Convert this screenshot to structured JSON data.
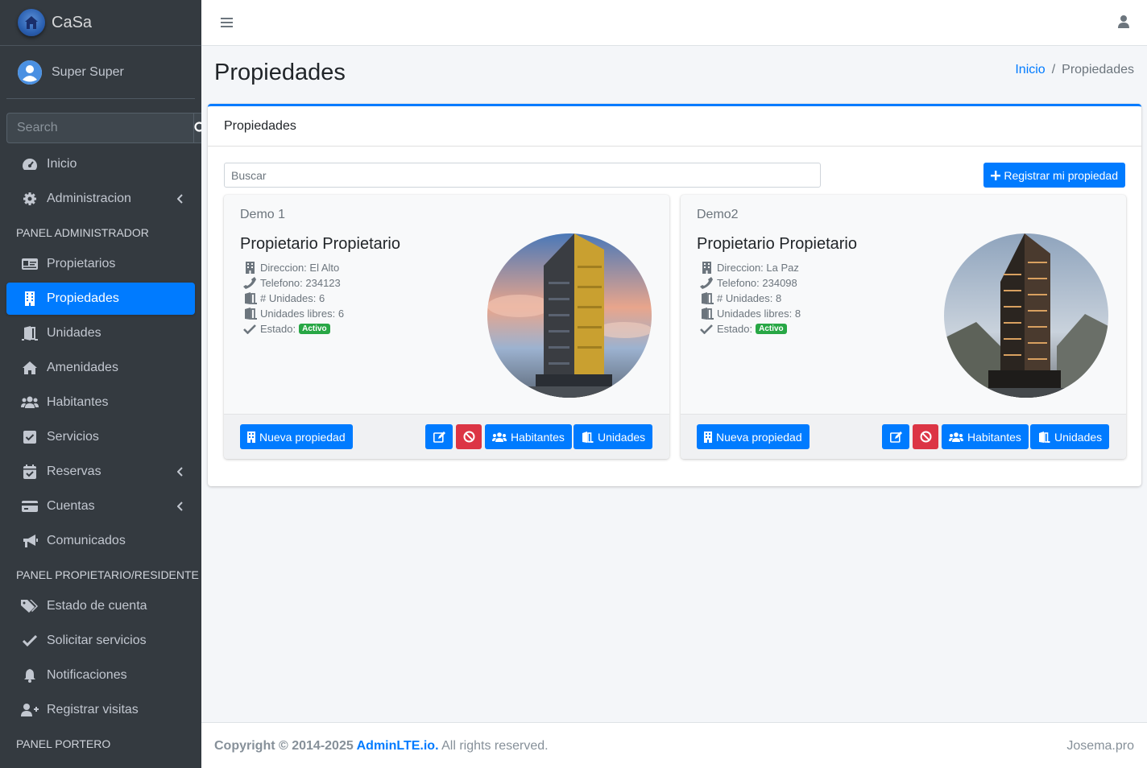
{
  "brand": {
    "name": "CaSa"
  },
  "user": {
    "name": "Super Super"
  },
  "sidebar": {
    "search_placeholder": "Search",
    "items": [
      {
        "label": "Inicio"
      },
      {
        "label": "Administracion"
      },
      {
        "header": "PANEL ADMINISTRADOR"
      },
      {
        "label": "Propietarios"
      },
      {
        "label": "Propiedades"
      },
      {
        "label": "Unidades"
      },
      {
        "label": "Amenidades"
      },
      {
        "label": "Habitantes"
      },
      {
        "label": "Servicios"
      },
      {
        "label": "Reservas"
      },
      {
        "label": "Cuentas"
      },
      {
        "label": "Comunicados"
      },
      {
        "header": "PANEL PROPIETARIO/RESIDENTE"
      },
      {
        "label": "Estado de cuenta"
      },
      {
        "label": "Solicitar servicios"
      },
      {
        "label": "Notificaciones"
      },
      {
        "label": "Registrar visitas"
      },
      {
        "header": "PANEL PORTERO"
      }
    ]
  },
  "header": {
    "title": "Propiedades",
    "breadcrumb": [
      "Inicio",
      "/",
      "Propiedades"
    ]
  },
  "main": {
    "card_title": "Propiedades",
    "search_placeholder": "Buscar",
    "register_label": "Registrar mi propiedad",
    "properties": [
      {
        "name": "Demo 1",
        "owner": "Propietario Propietario",
        "direccion": "Direccion: El Alto",
        "telefono": "Telefono: 234123",
        "unidades": "# Unidades: 6",
        "libres": "Unidades libres: 6",
        "estado": "Estado:",
        "badge": "Activo",
        "btn_nueva": "Nueva propiedad",
        "btn_habitantes": "Habitantes",
        "btn_unidades": "Unidades"
      },
      {
        "name": "Demo2",
        "owner": "Propietario Propietario",
        "direccion": "Direccion: La Paz",
        "telefono": "Telefono: 234098",
        "unidades": "# Unidades: 8",
        "libres": "Unidades libres: 8",
        "estado": "Estado:",
        "badge": "Activo",
        "btn_nueva": "Nueva propiedad",
        "btn_habitantes": "Habitantes",
        "btn_unidades": "Unidades"
      }
    ]
  },
  "footer": {
    "copyright": "Copyright © 2014-2025",
    "brand": "AdminLTE.io.",
    "rights": "All rights reserved.",
    "right": "Josema.pro"
  },
  "colors": {
    "primary": "#007bff",
    "danger": "#dc3545",
    "success": "#28a745",
    "sidebar": "#343a40"
  }
}
